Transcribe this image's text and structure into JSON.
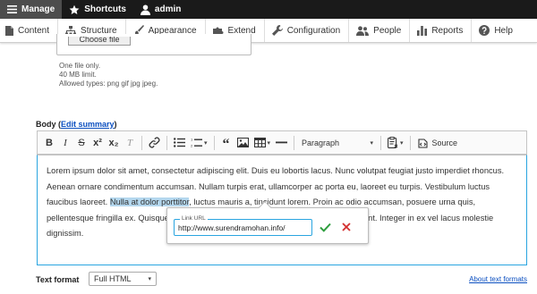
{
  "admin_bar": {
    "manage": "Manage",
    "shortcuts": "Shortcuts",
    "user": "admin"
  },
  "tray": {
    "items": [
      "Content",
      "Structure",
      "Appearance",
      "Extend",
      "Configuration",
      "People",
      "Reports",
      "Help"
    ]
  },
  "file_upload": {
    "button_label": "Choose file",
    "desc_lines": [
      "One file only.",
      "40 MB limit.",
      "Allowed types: png gif jpg jpeg."
    ]
  },
  "body_field": {
    "label": "Body",
    "open_paren": " (",
    "edit_summary": "Edit summary",
    "close_paren": ")"
  },
  "editor_toolbar": {
    "bold": "B",
    "italic": "I",
    "strike": "S",
    "superscript": "x²",
    "subscript": "x₂",
    "remove_format": "T",
    "heading_select": "Paragraph",
    "source": "Source"
  },
  "editor": {
    "text_before": "Lorem ipsum dolor sit amet, consectetur adipiscing elit. Duis eu lobortis lacus. Nunc volutpat feugiat justo imperdiet rhoncus. Aenean ornare condimentum accumsan. Nullam turpis erat, ullamcorper ac porta eu, laoreet eu turpis. Vestibulum luctus faucibus laoreet. ",
    "selected_text": "Nulla at dolor porttitor",
    "text_after": ", luctus mauris a, tincidunt lorem. Proin ac odio accumsan, posuere urna quis, pellentesque fringilla ex. Quisque sit amet fringilla. Etiam tempus iaculis elit eget tincidunt. Integer in ex vel lacus molestie dignissim."
  },
  "link_balloon": {
    "field_label": "Link URL",
    "value": "http://www.surendramohan.info/"
  },
  "text_format": {
    "label": "Text format",
    "selected": "Full HTML",
    "about_link": "About text formats"
  },
  "colors": {
    "accent": "#2aa5e0",
    "link": "#0b4fc0",
    "save_check": "#2e9e3e",
    "cancel_x": "#d32f2f",
    "selection": "#b4d7ee"
  }
}
